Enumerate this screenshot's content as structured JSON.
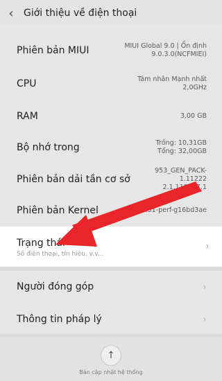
{
  "header": {
    "back_icon": "chevron-left-icon",
    "title": "Giới thiệu về điện thoại"
  },
  "rows": [
    {
      "label": "Phiên bản MIUI",
      "value_lines": [
        "MIUI Global 9.0 | Ổn định",
        "9.0.3.0(NCFMIEI)"
      ]
    },
    {
      "label": "CPU",
      "value_lines": [
        "Tám nhân Mạnh nhất",
        "2,0GHz"
      ]
    },
    {
      "label": "RAM",
      "value_lines": [
        "3,00 GB"
      ]
    },
    {
      "label": "Bộ nhớ trong",
      "value_lines": [
        "Trống: 10,31GB",
        "Tổng: 32,00GB"
      ]
    },
    {
      "label": "Phiên bản dải tần cơ sở",
      "value_lines": [
        "953_GEN_PACK-1.11222",
        "2.1.119607.1"
      ]
    },
    {
      "label": "Phiên bản Kernel",
      "value_lines": [
        "3.18.31-perf-g16bd3ae"
      ]
    }
  ],
  "status": {
    "label": "Trạng thái",
    "sublabel": "Số điện thoại, tín hiệu, v.v..."
  },
  "links": [
    {
      "label": "Người đóng góp"
    },
    {
      "label": "Thông tin pháp lý"
    }
  ],
  "footer": {
    "update_icon": "arrow-up-icon",
    "update_label": "Bản cập nhật hệ thống"
  },
  "colors": {
    "annotation_arrow": "#e8262a",
    "highlight_row": "#ffffff",
    "background": "#e6e6e6"
  }
}
